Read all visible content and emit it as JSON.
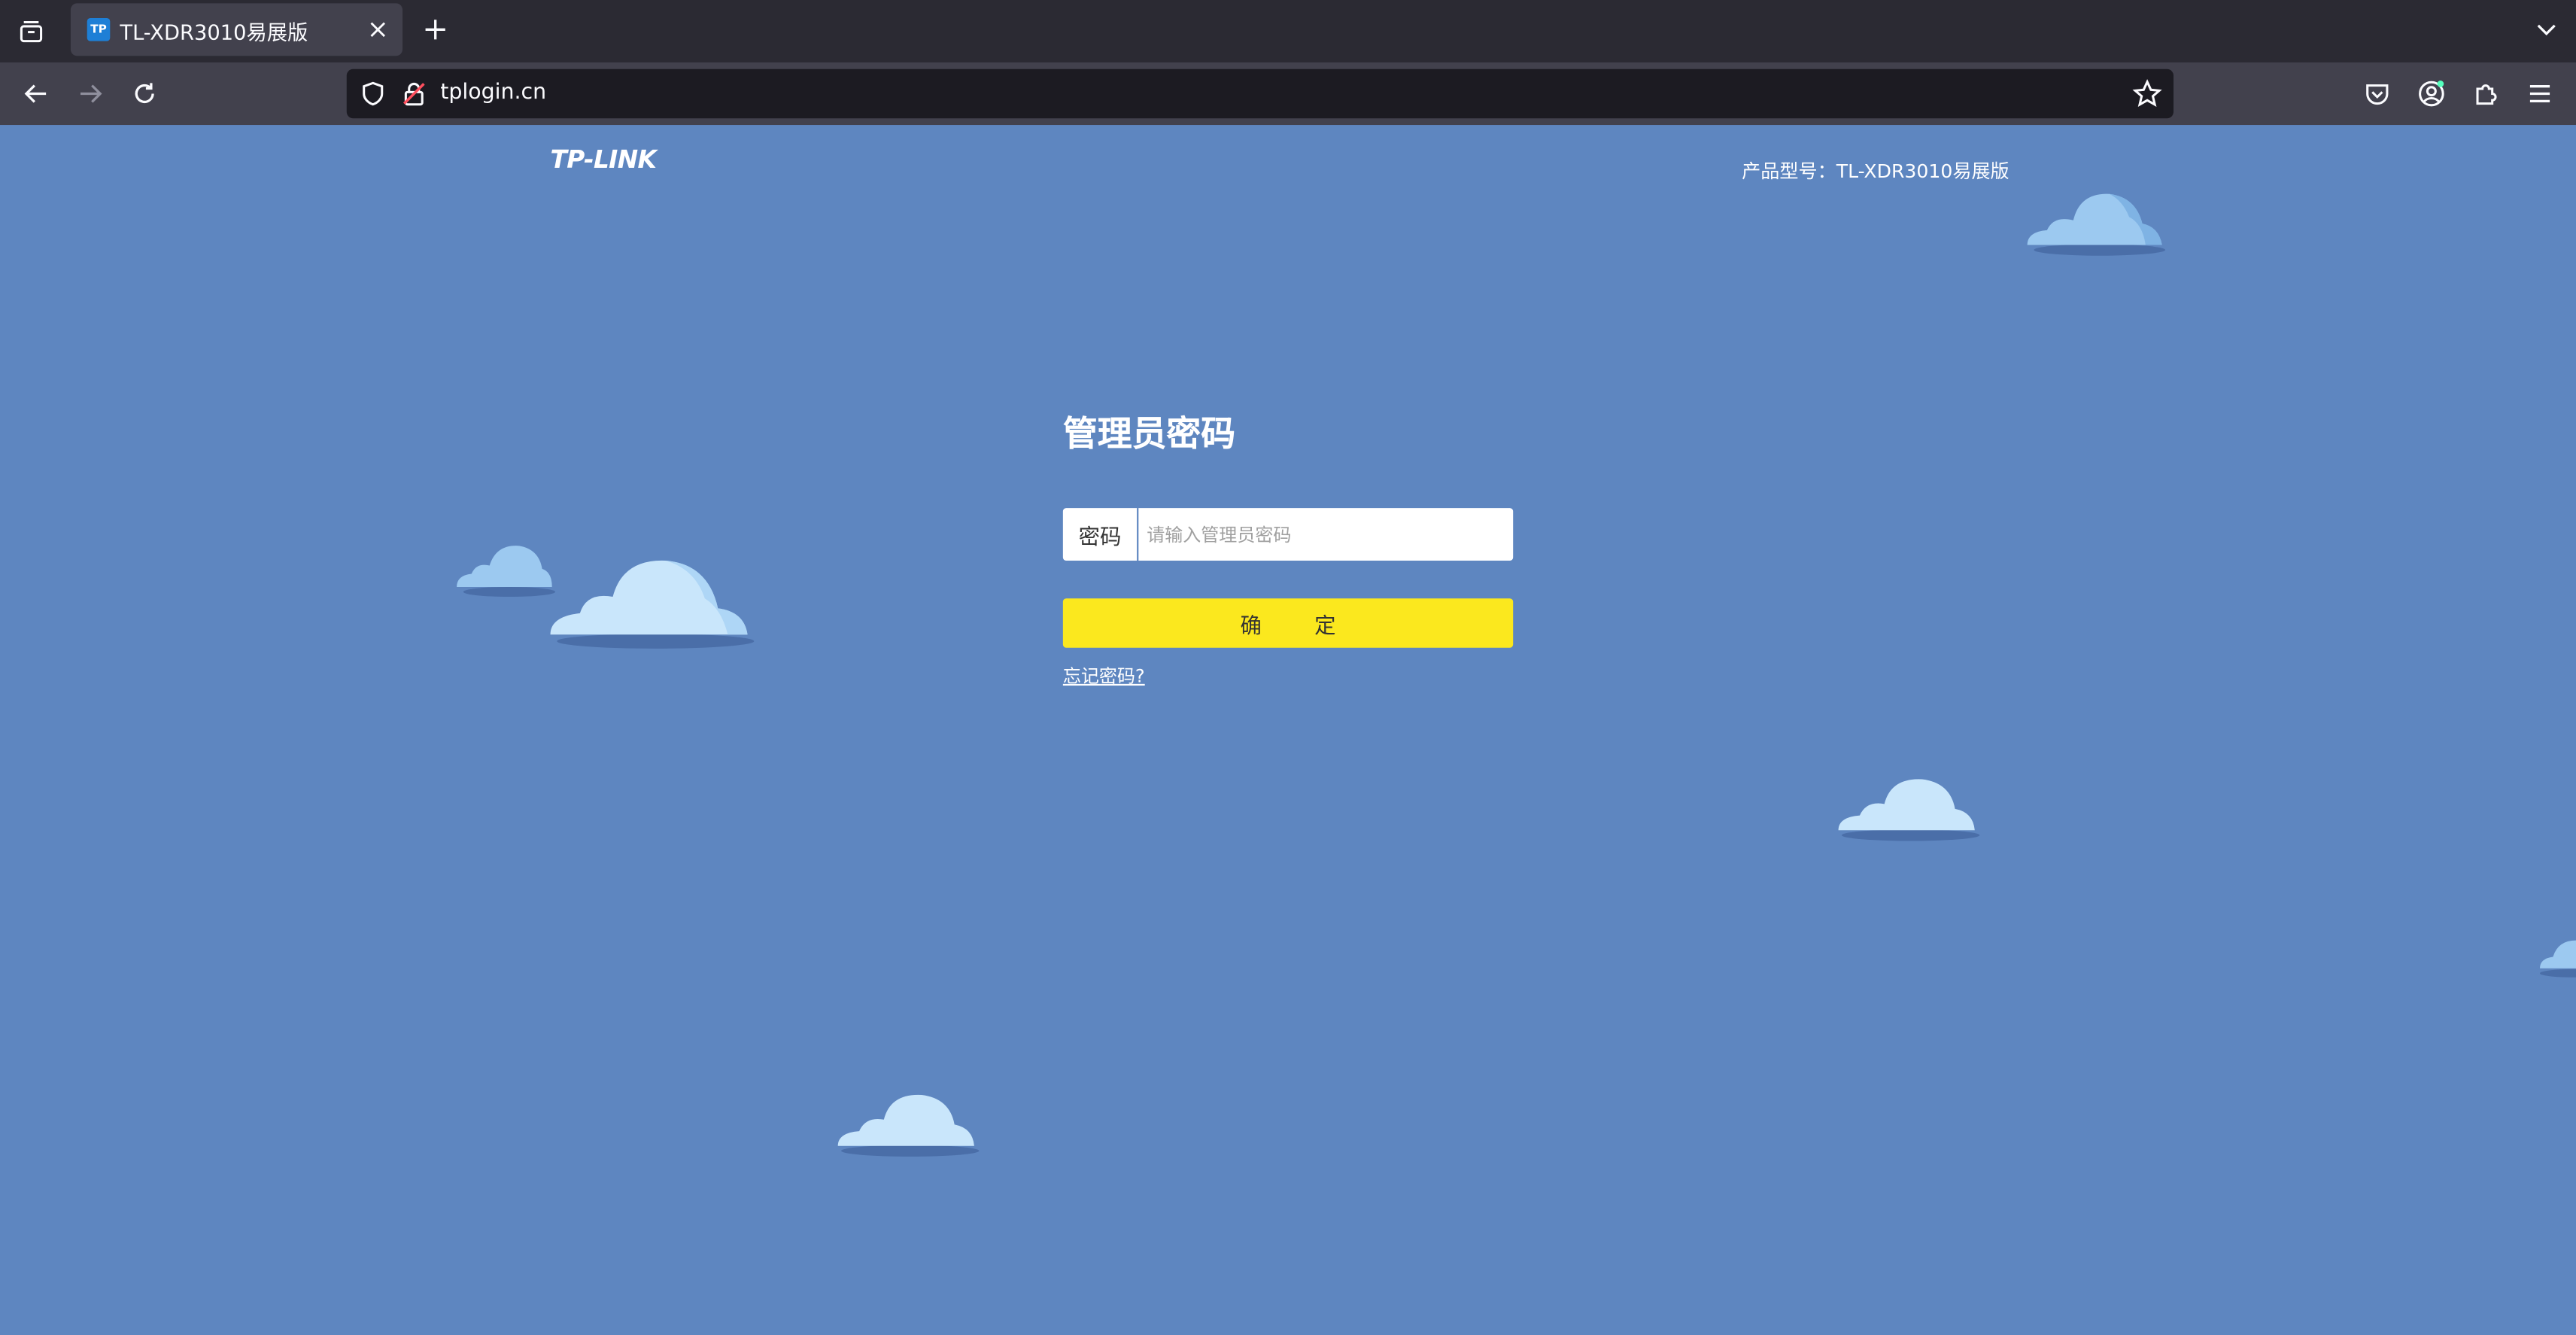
{
  "browser": {
    "tab": {
      "favicon_text": "TP",
      "title": "TL-XDR3010易展版"
    },
    "url": "tplogin.cn"
  },
  "page": {
    "logo": "TP-LINK",
    "model_label": "产品型号：TL-XDR3010易展版",
    "login": {
      "title": "管理员密码",
      "password_label": "密码",
      "password_placeholder": "请输入管理员密码",
      "password_value": "",
      "confirm_button": "确 定",
      "forgot_link": "忘记密码?"
    }
  },
  "colors": {
    "background": "#5e86c0",
    "button": "#fbe81e",
    "cloud_light": "#c9e6fb",
    "cloud_mid": "#9cc9f0",
    "cloud_shadow": "#4a6ea8"
  }
}
